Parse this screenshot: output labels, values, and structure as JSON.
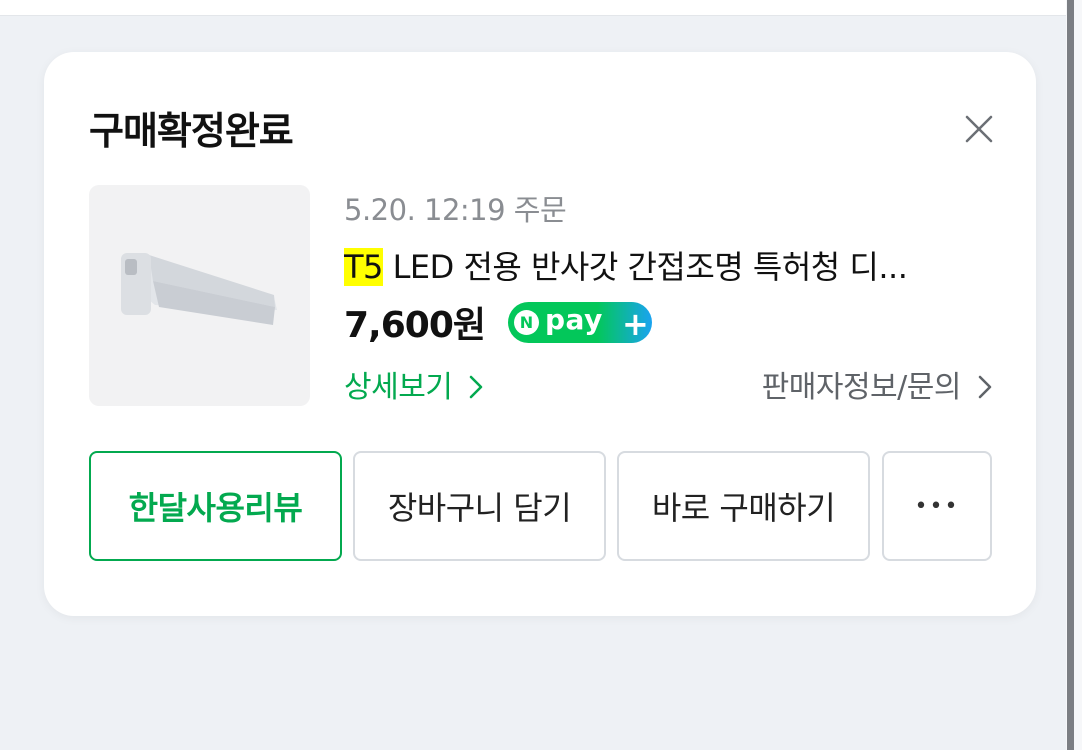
{
  "card": {
    "title": "구매확정완료",
    "order_date": "5.20. 12:19 주문",
    "product": {
      "name_highlight": "T5",
      "name_rest": " LED 전용 반사갓 간접조명 특허청 디...",
      "price": "7,600원",
      "payment_badge": {
        "n": "N",
        "text": "pay",
        "plus": "+"
      }
    },
    "links": {
      "detail": "상세보기",
      "seller": "판매자정보/문의"
    },
    "buttons": {
      "review": "한달사용리뷰",
      "cart": "장바구니 담기",
      "buy": "바로 구매하기",
      "more": "•••"
    }
  },
  "icons": {
    "close": "close-icon",
    "chevron": "chevron-right-icon",
    "more": "more-icon"
  },
  "colors": {
    "accent_green": "#03a94f",
    "highlight": "#ffff00",
    "npay_green": "#03c75a",
    "npay_blue": "#1aa3f0"
  }
}
